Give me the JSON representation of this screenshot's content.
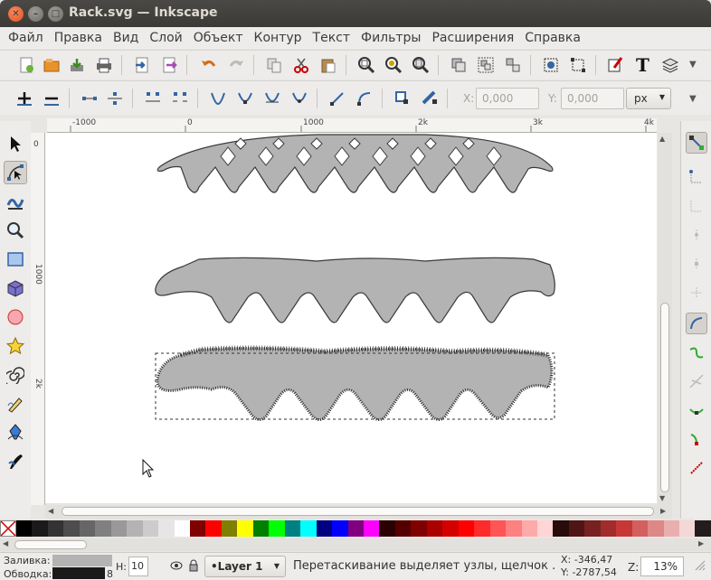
{
  "window": {
    "title": "Rack.svg — Inkscape"
  },
  "menubar": {
    "items": [
      "Файл",
      "Правка",
      "Вид",
      "Слой",
      "Объект",
      "Контур",
      "Текст",
      "Фильтры",
      "Расширения",
      "Справка"
    ]
  },
  "toolbar2": {
    "x_label": "X:",
    "x_value": "0,000",
    "y_label": "Y:",
    "y_value": "0,000",
    "unit": "px"
  },
  "ruler": {
    "h_labels": [
      "-1000",
      "0",
      "1000",
      "2k",
      "3k",
      "4k"
    ],
    "v_labels": [
      "0",
      "1000",
      "2k"
    ]
  },
  "palette": {
    "colors": [
      "#000000",
      "#1a1a1a",
      "#333333",
      "#4d4d4d",
      "#666666",
      "#808080",
      "#999999",
      "#b3b3b3",
      "#cccccc",
      "#e6e6e6",
      "#ffffff",
      "#800000",
      "#ff0000",
      "#808000",
      "#ffff00",
      "#008000",
      "#00ff00",
      "#008080",
      "#00ffff",
      "#000080",
      "#0000ff",
      "#800080",
      "#ff00ff",
      "#2b0000",
      "#550000",
      "#800000",
      "#aa0000",
      "#d40000",
      "#ff0000",
      "#ff2a2a",
      "#ff5555",
      "#ff8080",
      "#ffaaaa",
      "#ffd5d5",
      "#280b0b",
      "#501616",
      "#782121",
      "#a02c2c",
      "#c83737",
      "#d35f5f",
      "#de8787",
      "#e9afaf",
      "#f4d7d7",
      "#241c1c"
    ]
  },
  "status": {
    "fill_label": "Заливка:",
    "stroke_label": "Обводка:",
    "stroke_width": "8",
    "h_label": "H:",
    "h_value": "10",
    "layer": "•Layer 1",
    "message": "Перетаскивание выделяет узлы, щелчок .",
    "x_readout": "X: -346,47",
    "y_readout": "Y: -2787,54",
    "z_label": "Z:",
    "zoom": "13%"
  },
  "colors": {
    "shape_fill": "#b3b3b3",
    "shape_stroke": "#3a3a3a",
    "accent": "#e0501e"
  }
}
